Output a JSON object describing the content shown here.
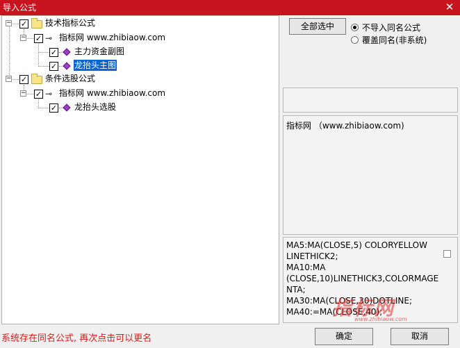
{
  "window": {
    "title": "导入公式",
    "close_glyph": "✕"
  },
  "tree": {
    "group1": {
      "label": "技术指标公式",
      "site_label": "指标网 www.zhibiaow.com",
      "items": [
        "主力资金副图",
        "龙抬头主图"
      ]
    },
    "group2": {
      "label": "条件选股公式",
      "site_label": "指标网 www.zhibiaow.com",
      "items": [
        "龙抬头选股"
      ]
    },
    "selected_item": "龙抬头主图"
  },
  "right": {
    "select_all_label": "全部选中",
    "radio_options": [
      "不导入同名公式",
      "覆盖同名(非系统)"
    ],
    "radio_selected_index": 0,
    "description": "指标网 （www.zhibiaow.com)",
    "code_lines": [
      "MA5:MA(CLOSE,5) COLORYELLOW",
      "LINETHICK2;",
      "MA10:MA",
      "(CLOSE,10)LINETHICK3,COLORMAGE",
      "NTA;",
      "MA30:MA(CLOSE,30)DOTLINE;",
      "MA40:=MA(CLOSE,40);"
    ]
  },
  "status_text": "系统存在同名公式, 再次点击可以更名",
  "buttons": {
    "ok": "确定",
    "cancel": "取消"
  },
  "watermark": {
    "main": "指标网",
    "sub": "www.zhibiaow.com"
  },
  "colors": {
    "titlebar": "#c8141e",
    "status_text": "#d21e1e",
    "selection": "#0a64d4"
  }
}
